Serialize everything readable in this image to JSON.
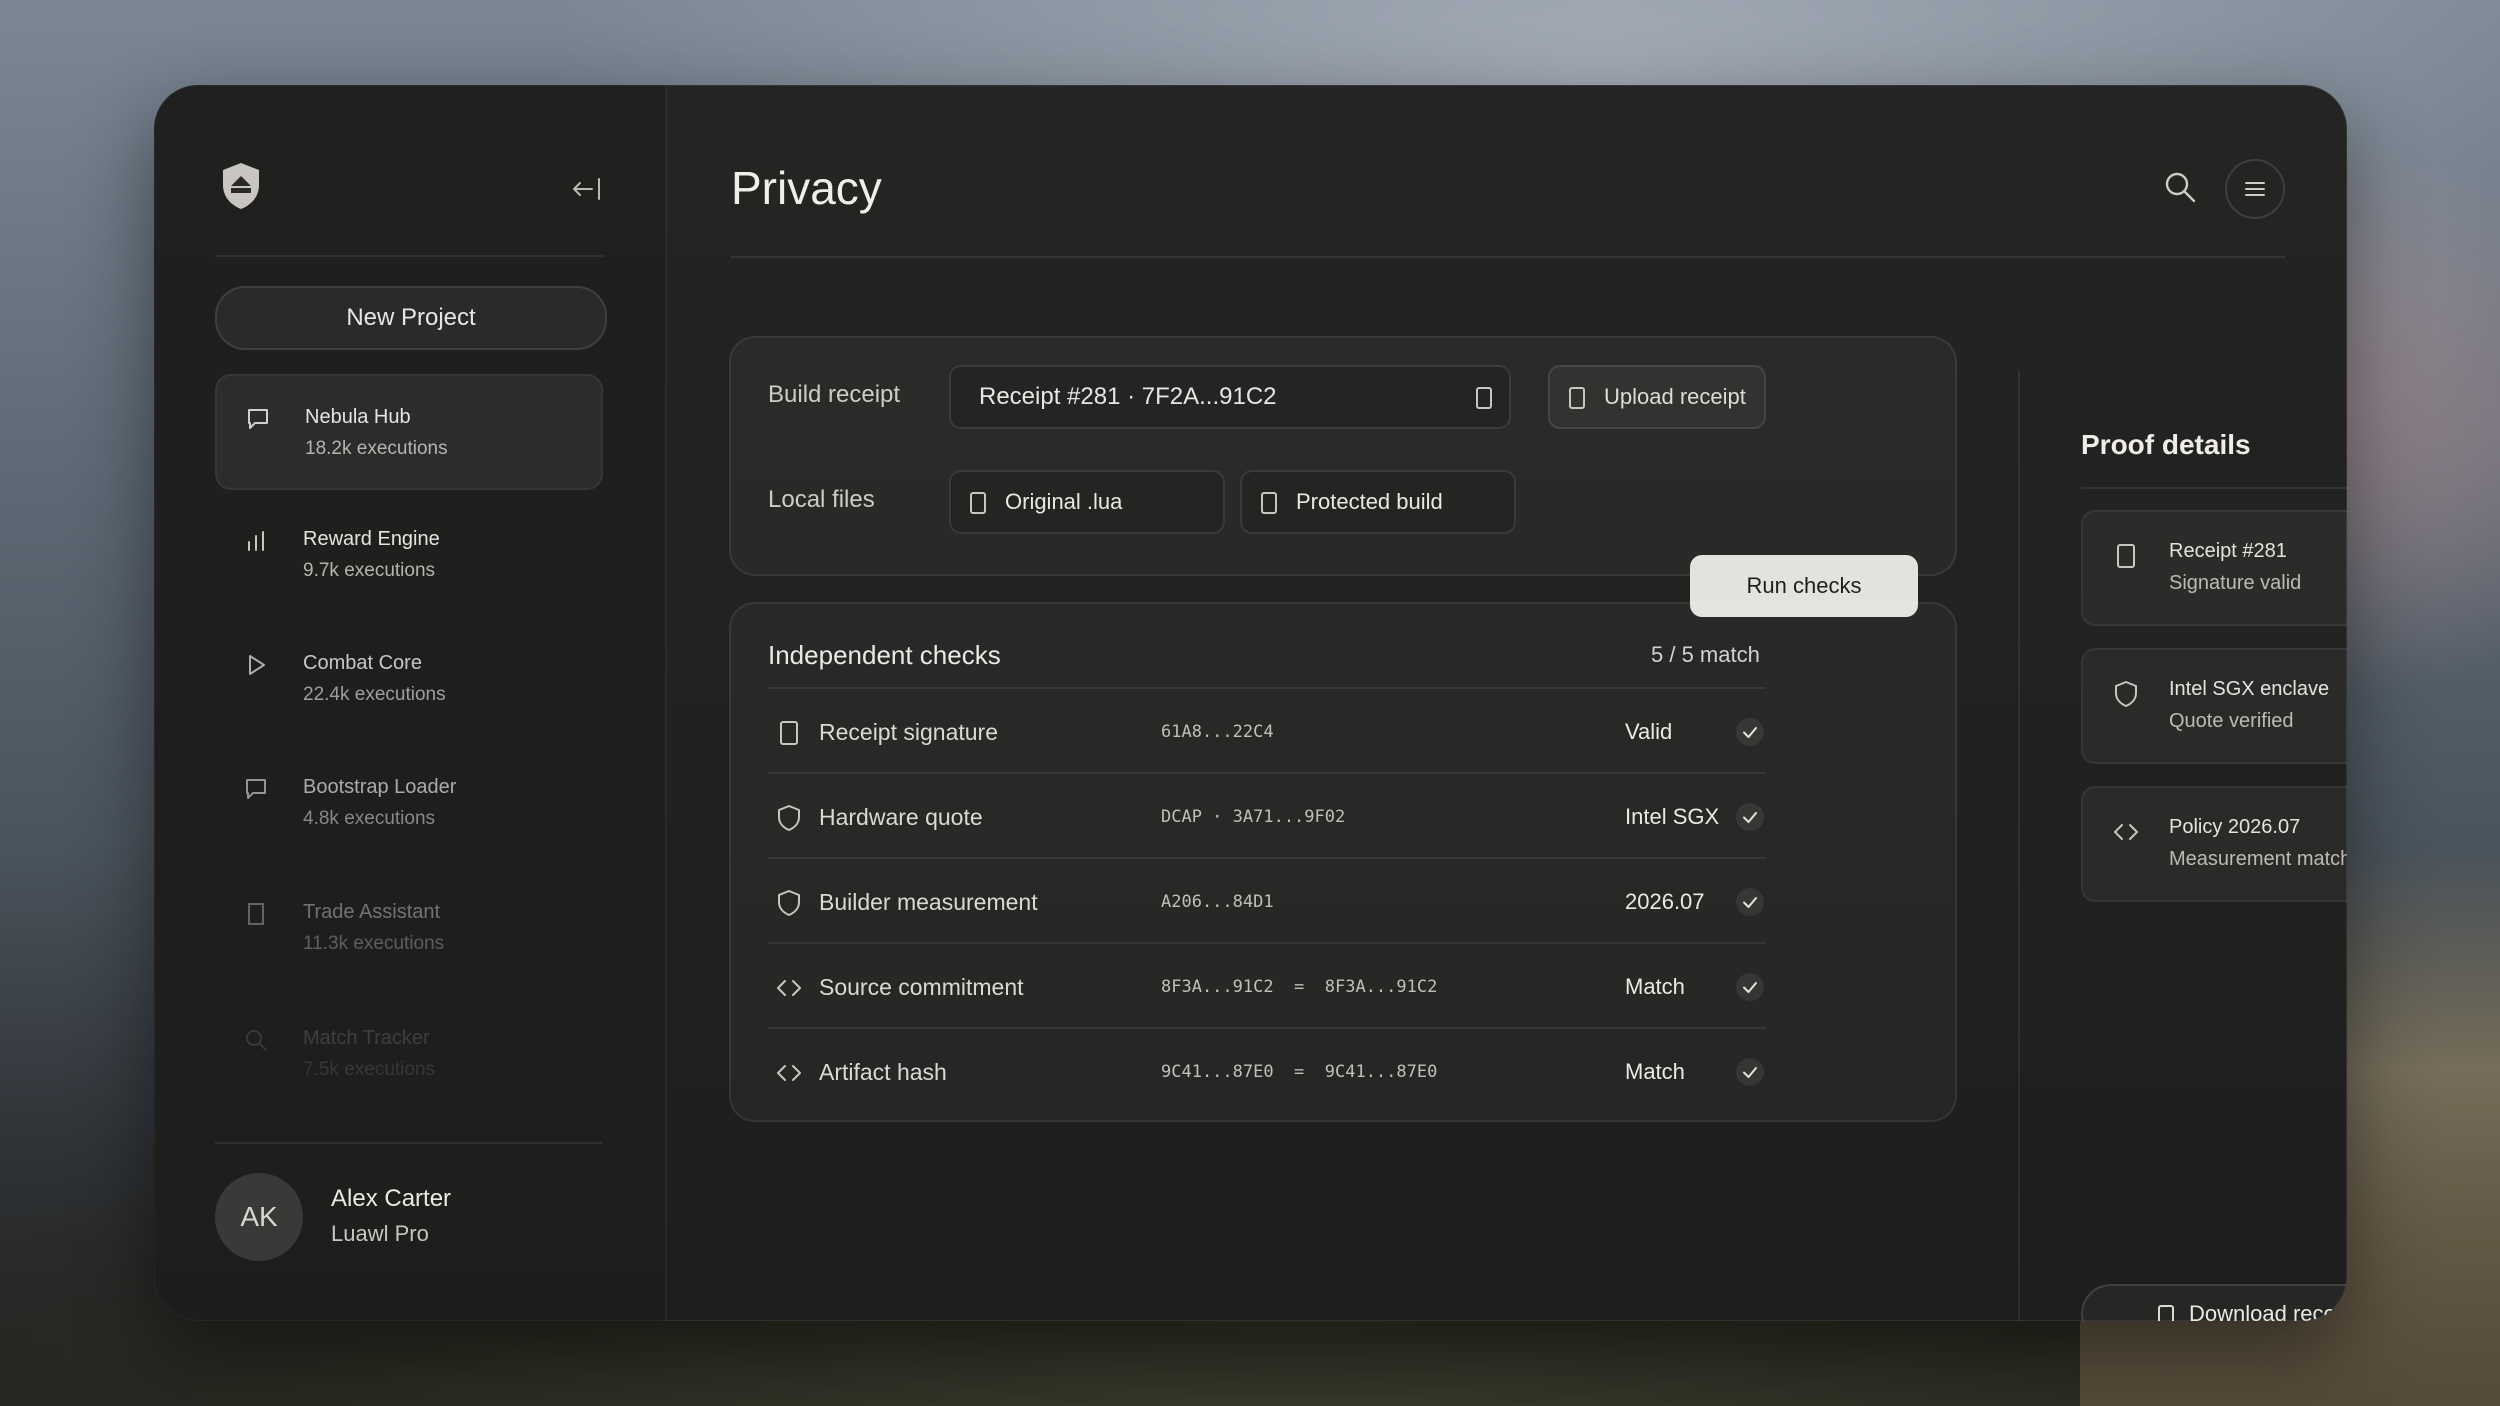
{
  "sidebar": {
    "new_project_label": "New Project",
    "items": [
      {
        "title": "Nebula Hub",
        "sub": "18.2k executions",
        "icon": "chat-icon"
      },
      {
        "title": "Reward Engine",
        "sub": "9.7k executions",
        "icon": "bar-chart-icon"
      },
      {
        "title": "Combat Core",
        "sub": "22.4k executions",
        "icon": "play-icon"
      },
      {
        "title": "Bootstrap Loader",
        "sub": "4.8k executions",
        "icon": "chat-icon"
      },
      {
        "title": "Trade Assistant",
        "sub": "11.3k executions",
        "icon": "document-icon"
      },
      {
        "title": "Match Tracker",
        "sub": "7.5k executions",
        "icon": "search-icon"
      }
    ],
    "user": {
      "initials": "AK",
      "name": "Alex Carter",
      "plan": "Luawl Pro"
    }
  },
  "header": {
    "title": "Privacy"
  },
  "inputs": {
    "build_receipt_label": "Build receipt",
    "receipt_value": "Receipt #281 · 7F2A...91C2",
    "upload_label": "Upload receipt",
    "local_files_label": "Local files",
    "original_file": "Original .lua",
    "protected_file": "Protected build",
    "run_label": "Run checks"
  },
  "checks": {
    "title": "Independent checks",
    "summary": "5 / 5 match",
    "rows": [
      {
        "name": "Receipt signature",
        "hash": "61A8...22C4",
        "result": "Valid",
        "icon": "document-icon"
      },
      {
        "name": "Hardware quote",
        "hash": "DCAP · 3A71...9F02",
        "result": "Intel SGX",
        "icon": "shield-icon"
      },
      {
        "name": "Builder measurement",
        "hash": "A206...84D1",
        "result": "2026.07",
        "icon": "shield-icon"
      },
      {
        "name": "Source commitment",
        "hash": "8F3A...91C2  =  8F3A...91C2",
        "result": "Match",
        "icon": "code-icon"
      },
      {
        "name": "Artifact hash",
        "hash": "9C41...87E0  =  9C41...87E0",
        "result": "Match",
        "icon": "code-icon"
      }
    ]
  },
  "proof": {
    "title": "Proof details",
    "cards": [
      {
        "title": "Receipt #281",
        "sub": "Signature valid",
        "icon": "document-icon"
      },
      {
        "title": "Intel SGX enclave",
        "sub": "Quote verified",
        "icon": "shield-icon"
      },
      {
        "title": "Policy 2026.07",
        "sub": "Measurement matched",
        "icon": "code-icon"
      }
    ],
    "download_label": "Download receipt"
  },
  "colors": {
    "accent": "#e4e2de",
    "panel": "#222221",
    "text": "#ece9e5"
  }
}
